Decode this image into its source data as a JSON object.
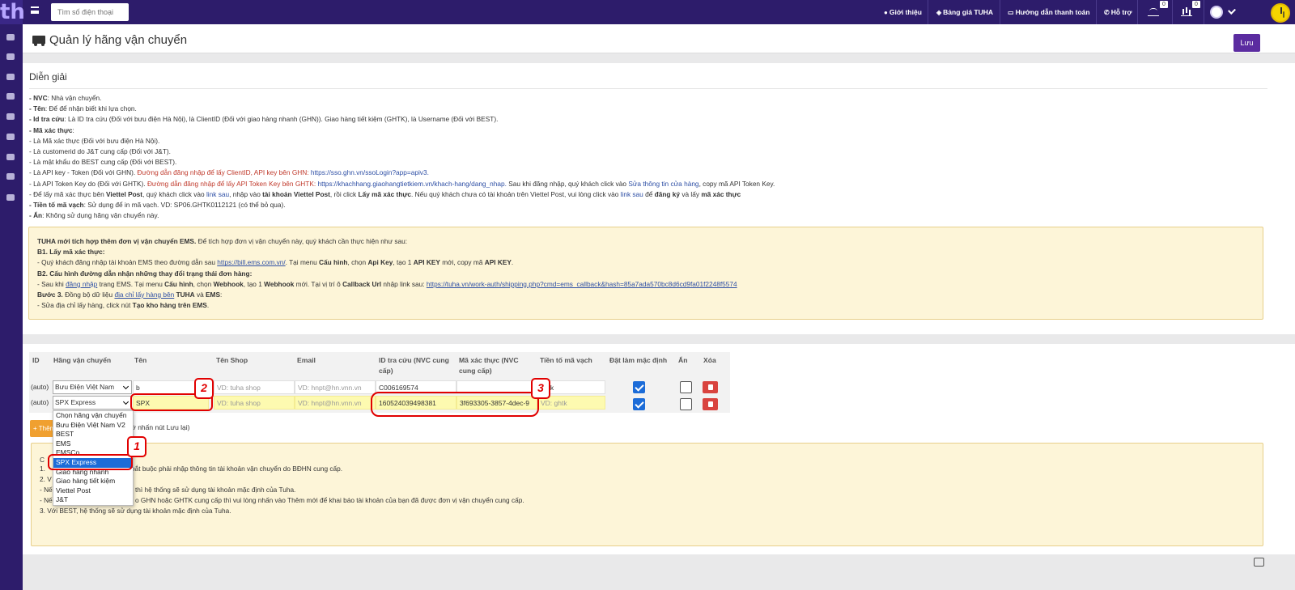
{
  "topbar": {
    "logo": "th",
    "search_placeholder": "Tìm số điện thoại",
    "nav": {
      "intro": "Giới thiệu",
      "pricing": "Bảng giá TUHA",
      "payment_guide": "Hướng dẫn thanh toán",
      "support": "Hỗ trợ"
    },
    "badge1": "0",
    "badge2": "0"
  },
  "page": {
    "title": "Quản lý hãng vận chuyển",
    "save_label": "Lưu"
  },
  "explain": {
    "title": "Diễn giải",
    "l1b": "- NVC",
    "l1": ": Nhà vận chuyển.",
    "l2b": "- Tên",
    "l2": ": Để để nhận biết khi lựa chọn.",
    "l3b": "- Id tra cứu",
    "l3": ": Là ID tra cứu (Đối với bưu điện Hà Nội), là ClientID (Đối với giao hàng nhanh (GHN)). Giao hàng tiết kiệm (GHTK), là Username (Đối với BEST).",
    "l4b": "- Mã xác thực",
    "l4": ":",
    "l5": "- Là Mã xác thực (Đối với bưu điện Hà Nội).",
    "l6": "- Là customerid do J&T cung cấp (Đối với J&T).",
    "l7": "- Là mật khẩu do BEST cung cấp (Đối với BEST).",
    "l8a": "- Là API key - Token (Đối với GHN).",
    "l8b": "Đường dẫn đăng nhập để lấy ClientID, API key bên GHN:",
    "l8c": "https://sso.ghn.vn/ssoLogin?app=apiv3.",
    "l9a": "- Là API Token Key do (Đối với GHTK).",
    "l9b": "Đường dẫn đăng nhập để lấy API Token Key bên GHTK:",
    "l9c": "https://khachhang.giaohangtietkiem.vn/khach-hang/dang_nhap.",
    "l9d": "Sau khi đăng nhập, quý khách click vào",
    "l9e": "Sửa thông tin cửa hàng",
    "l9f": ", copy mã API Token Key.",
    "l10a": "- Để lấy mã xác thực bên",
    "l10b": "Viettel Post",
    "l10c": ", quý khách click vào",
    "l10d": "link sau",
    "l10e": ", nhập vào",
    "l10f": "tài khoản Viettel Post",
    "l10g": ", rồi click",
    "l10h": "Lấy mã xác thực",
    "l10i": ". Nếu quý khách chưa có tài khoản trên Viettel Post, vui lòng click vào",
    "l10j": "link sau",
    "l10k": "để",
    "l10l": "đăng ký",
    "l10m": "và lấy",
    "l10n": "mã xác thực",
    "l11b": "- Tiền tố mã vạch",
    "l11": ": Sử dụng để in mã vạch. VD: SP06.GHTK0112121 (có thể bỏ qua).",
    "l12b": "- Ẩn",
    "l12": ": Không sử dụng hãng vận chuyển này."
  },
  "ems": {
    "h1b": "TUHA mới tích hợp thêm đơn vị vận chuyển EMS.",
    "h1": "Để tích hợp đơn vị vận chuyển này, quý khách cần thực hiện như sau:",
    "b1": "B1. Lấy mã xác thực:",
    "b1a": "- Quý khách đăng nhập tài khoản EMS theo đường dẫn sau",
    "b1link": "https://bill.ems.com.vn/",
    "b1b": ". Tại menu",
    "b1c": "Cấu hình",
    "b1d": ", chọn",
    "b1e": "Api Key",
    "b1f": ", tạo 1",
    "b1g": "API KEY",
    "b1h": "mới, copy mã",
    "b1i": "API KEY",
    "b2": "B2. Cấu hình đường dẫn nhận những thay đổi trạng thái đơn hàng:",
    "b2a": "- Sau khi",
    "b2link1": "đăng nhập",
    "b2b": "trang EMS. Tại menu",
    "b2c": "Cấu hình",
    "b2d": ", chọn",
    "b2e": "Webhook",
    "b2f": ", tạo 1",
    "b2g": "Webhook",
    "b2h": "mới. Tại vị trí ô",
    "b2i": "Callback Url",
    "b2j": "nhập link sau:",
    "b2link2": "https://tuha.vn/work-auth/shipping.php?cmd=ems_callback&hash=85a7ada570bc8d6cd9fa01f2248f5574",
    "b3": "Bước 3.",
    "b3a": "Đồng bộ dữ liệu",
    "b3link": "địa chỉ lấy hàng bên",
    "b3b": "TUHA",
    "b3c": "và",
    "b3d": "EMS",
    "b3e": "- Sửa địa chỉ lấy hàng, click nút",
    "b3f": "Tạo kho hàng trên EMS"
  },
  "table": {
    "headers": [
      "ID",
      "Hãng vận chuyển",
      "Tên",
      "Tên Shop",
      "Email",
      "ID tra cứu (NVC cung cấp)",
      "Mã xác thực (NVC cung cấp)",
      "Tiền tố mã vạch",
      "Đặt làm mặc định",
      "Ẩn",
      "Xóa"
    ],
    "rows": [
      {
        "id": "(auto)",
        "carrier": "Bưu Điện Việt Nam",
        "name": "b",
        "shop_ph": "VD: tuha shop",
        "email_ph": "VD: hnpt@hn.vnn.vn",
        "lookup_id": "C006169574",
        "auth_code": "",
        "prefix": "ghtk",
        "default": true,
        "hidden": false
      },
      {
        "id": "(auto)",
        "carrier": "SPX Express",
        "name": "SPX",
        "shop_ph": "VD: tuha shop",
        "email_ph": "VD: hnpt@hn.vnn.vn",
        "lookup_id": "160524039498381",
        "auth_code": "3f693305-3857-4dec-9",
        "prefix_ph": "VD: ghtk",
        "default": true,
        "hidden": false
      }
    ],
    "add_label": "+ Thêm",
    "add_note": "an nhớ nhấn nút Lưu lại)"
  },
  "dropdown": {
    "options": [
      "Chọn hãng vận chuyển",
      "Bưu Điện Việt Nam V2",
      "BEST",
      "EMS",
      "EMSCo...",
      "SPX Express",
      "Giao hàng nhanh",
      "Giao hàng tiết kiệm",
      "Viettel Post",
      "J&T"
    ],
    "selected_index": 5
  },
  "notes": {
    "n0": "C",
    "n1": "1.",
    "n1b": "bắt buộc phải nhập thông tin tài khoản vận chuyển do BĐHN cung cấp.",
    "n2": "2. V",
    "n3": "- Nế",
    "n3b": "thì hệ thống sẽ sử dụng tài khoản mặc định của Tuha.",
    "n4": "- Nế",
    "n4b": "o GHN hoặc GHTK cung cấp thì vui lòng nhấn vào Thêm mới để khai báo tài khoản của bạn đã được đơn vị vận chuyển cung cấp.",
    "n5": "3. Với BEST, hệ thống sẽ sử dụng tài khoản mặc định của Tuha."
  },
  "annotations": [
    "1",
    "2",
    "3"
  ],
  "colors": {
    "brand": "#2d1c6b",
    "save": "#5b2ca0",
    "annotation": "#e10000",
    "highlight": "#fdfab0"
  }
}
